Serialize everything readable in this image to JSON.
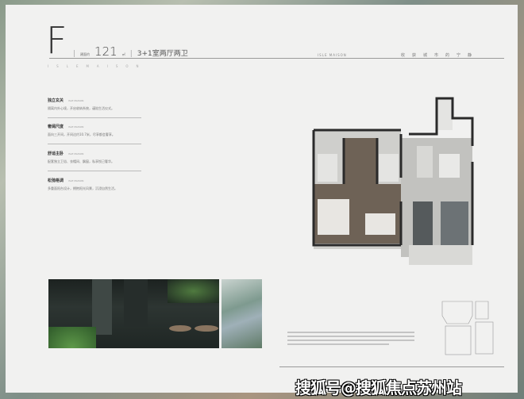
{
  "unit": {
    "letter": "F",
    "area_prefix": "建面约",
    "area": "121",
    "area_unit": "㎡",
    "layout": "3+1室两厅两卫"
  },
  "brand": {
    "spaced": "ISLEMAISON",
    "name": "ISLE MAISON",
    "slogan": "收获城市的宁静"
  },
  "features": [
    {
      "title": "独立玄关",
      "tag": "ISLE MAISON",
      "desc": "隔离内外心境，开启收纳系统，谨陪生活仪式。"
    },
    {
      "title": "奢阔尺度",
      "tag": "ISLE MAISON",
      "desc": "面向三开间，开间达约10.7米，尽享都会奢享。"
    },
    {
      "title": "舒适主卧",
      "tag": "ISLE MAISON",
      "desc": "配套独立卫浴、衣帽间、飘窗，私享悦己奢华。"
    },
    {
      "title": "松弛格调",
      "tag": "ISLE MAISON",
      "desc": "多重面阳台设计，拥抱阳光风景，沉浸自然生活。"
    }
  ],
  "watermark": "搜狐号@搜狐焦点苏州站",
  "colors": {
    "card": "#f1f1f0",
    "wood": "#6e6256",
    "stone": "#c9c9c7",
    "wall": "#2a2a2a"
  }
}
